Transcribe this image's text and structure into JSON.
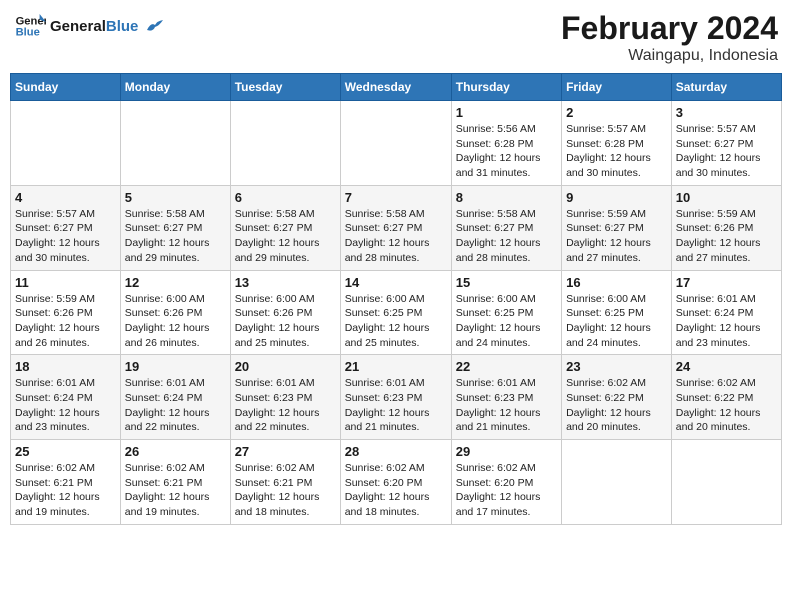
{
  "logo": {
    "text_general": "General",
    "text_blue": "Blue"
  },
  "header": {
    "title": "February 2024",
    "subtitle": "Waingapu, Indonesia"
  },
  "days_of_week": [
    "Sunday",
    "Monday",
    "Tuesday",
    "Wednesday",
    "Thursday",
    "Friday",
    "Saturday"
  ],
  "weeks": [
    [
      {
        "day": "",
        "info": ""
      },
      {
        "day": "",
        "info": ""
      },
      {
        "day": "",
        "info": ""
      },
      {
        "day": "",
        "info": ""
      },
      {
        "day": "1",
        "info": "Sunrise: 5:56 AM\nSunset: 6:28 PM\nDaylight: 12 hours\nand 31 minutes."
      },
      {
        "day": "2",
        "info": "Sunrise: 5:57 AM\nSunset: 6:28 PM\nDaylight: 12 hours\nand 30 minutes."
      },
      {
        "day": "3",
        "info": "Sunrise: 5:57 AM\nSunset: 6:27 PM\nDaylight: 12 hours\nand 30 minutes."
      }
    ],
    [
      {
        "day": "4",
        "info": "Sunrise: 5:57 AM\nSunset: 6:27 PM\nDaylight: 12 hours\nand 30 minutes."
      },
      {
        "day": "5",
        "info": "Sunrise: 5:58 AM\nSunset: 6:27 PM\nDaylight: 12 hours\nand 29 minutes."
      },
      {
        "day": "6",
        "info": "Sunrise: 5:58 AM\nSunset: 6:27 PM\nDaylight: 12 hours\nand 29 minutes."
      },
      {
        "day": "7",
        "info": "Sunrise: 5:58 AM\nSunset: 6:27 PM\nDaylight: 12 hours\nand 28 minutes."
      },
      {
        "day": "8",
        "info": "Sunrise: 5:58 AM\nSunset: 6:27 PM\nDaylight: 12 hours\nand 28 minutes."
      },
      {
        "day": "9",
        "info": "Sunrise: 5:59 AM\nSunset: 6:27 PM\nDaylight: 12 hours\nand 27 minutes."
      },
      {
        "day": "10",
        "info": "Sunrise: 5:59 AM\nSunset: 6:26 PM\nDaylight: 12 hours\nand 27 minutes."
      }
    ],
    [
      {
        "day": "11",
        "info": "Sunrise: 5:59 AM\nSunset: 6:26 PM\nDaylight: 12 hours\nand 26 minutes."
      },
      {
        "day": "12",
        "info": "Sunrise: 6:00 AM\nSunset: 6:26 PM\nDaylight: 12 hours\nand 26 minutes."
      },
      {
        "day": "13",
        "info": "Sunrise: 6:00 AM\nSunset: 6:26 PM\nDaylight: 12 hours\nand 25 minutes."
      },
      {
        "day": "14",
        "info": "Sunrise: 6:00 AM\nSunset: 6:25 PM\nDaylight: 12 hours\nand 25 minutes."
      },
      {
        "day": "15",
        "info": "Sunrise: 6:00 AM\nSunset: 6:25 PM\nDaylight: 12 hours\nand 24 minutes."
      },
      {
        "day": "16",
        "info": "Sunrise: 6:00 AM\nSunset: 6:25 PM\nDaylight: 12 hours\nand 24 minutes."
      },
      {
        "day": "17",
        "info": "Sunrise: 6:01 AM\nSunset: 6:24 PM\nDaylight: 12 hours\nand 23 minutes."
      }
    ],
    [
      {
        "day": "18",
        "info": "Sunrise: 6:01 AM\nSunset: 6:24 PM\nDaylight: 12 hours\nand 23 minutes."
      },
      {
        "day": "19",
        "info": "Sunrise: 6:01 AM\nSunset: 6:24 PM\nDaylight: 12 hours\nand 22 minutes."
      },
      {
        "day": "20",
        "info": "Sunrise: 6:01 AM\nSunset: 6:23 PM\nDaylight: 12 hours\nand 22 minutes."
      },
      {
        "day": "21",
        "info": "Sunrise: 6:01 AM\nSunset: 6:23 PM\nDaylight: 12 hours\nand 21 minutes."
      },
      {
        "day": "22",
        "info": "Sunrise: 6:01 AM\nSunset: 6:23 PM\nDaylight: 12 hours\nand 21 minutes."
      },
      {
        "day": "23",
        "info": "Sunrise: 6:02 AM\nSunset: 6:22 PM\nDaylight: 12 hours\nand 20 minutes."
      },
      {
        "day": "24",
        "info": "Sunrise: 6:02 AM\nSunset: 6:22 PM\nDaylight: 12 hours\nand 20 minutes."
      }
    ],
    [
      {
        "day": "25",
        "info": "Sunrise: 6:02 AM\nSunset: 6:21 PM\nDaylight: 12 hours\nand 19 minutes."
      },
      {
        "day": "26",
        "info": "Sunrise: 6:02 AM\nSunset: 6:21 PM\nDaylight: 12 hours\nand 19 minutes."
      },
      {
        "day": "27",
        "info": "Sunrise: 6:02 AM\nSunset: 6:21 PM\nDaylight: 12 hours\nand 18 minutes."
      },
      {
        "day": "28",
        "info": "Sunrise: 6:02 AM\nSunset: 6:20 PM\nDaylight: 12 hours\nand 18 minutes."
      },
      {
        "day": "29",
        "info": "Sunrise: 6:02 AM\nSunset: 6:20 PM\nDaylight: 12 hours\nand 17 minutes."
      },
      {
        "day": "",
        "info": ""
      },
      {
        "day": "",
        "info": ""
      }
    ]
  ]
}
